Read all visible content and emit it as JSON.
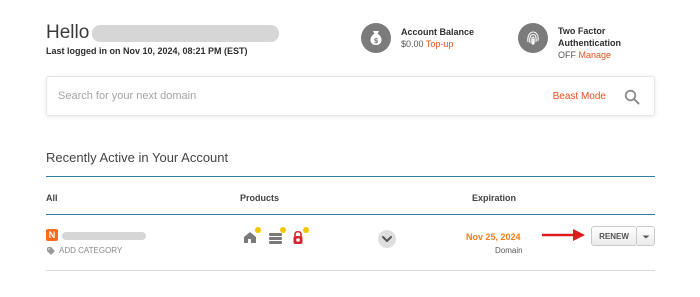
{
  "header": {
    "hello": "Hello",
    "last_logged": "Last logged in on Nov 10, 2024, 08:21 PM (EST)"
  },
  "account_balance": {
    "title": "Account Balance",
    "amount": "$0.00",
    "action": "Top-up"
  },
  "two_factor": {
    "title_line1": "Two Factor",
    "title_line2": "Authentication",
    "status": "OFF",
    "action": "Manage"
  },
  "search": {
    "placeholder": "Search for your next domain",
    "beast_mode": "Beast Mode"
  },
  "recent": {
    "title": "Recently Active in Your Account",
    "columns": {
      "all": "All",
      "products": "Products",
      "expiration": "Expiration"
    },
    "rows": [
      {
        "add_category": "ADD CATEGORY",
        "expiration_date": "Nov 25, 2024",
        "expiration_type": "Domain",
        "renew_label": "RENEW"
      }
    ]
  },
  "icons": {
    "balance": "money-bag-icon",
    "two_factor": "fingerprint-icon",
    "search": "search-icon",
    "expand": "chevron-down-icon",
    "tag": "tag-icon",
    "products": [
      "hosting-house-icon",
      "server-stack-icon",
      "email-lock-icon"
    ],
    "annotation": "red-arrow-icon"
  },
  "colors": {
    "accent_orange": "#e8501e",
    "expiration_orange": "#f07d1b",
    "rule_blue": "#2f7fa4",
    "arrow_red": "#e01b1b",
    "badge_yellow": "#f3c400"
  }
}
